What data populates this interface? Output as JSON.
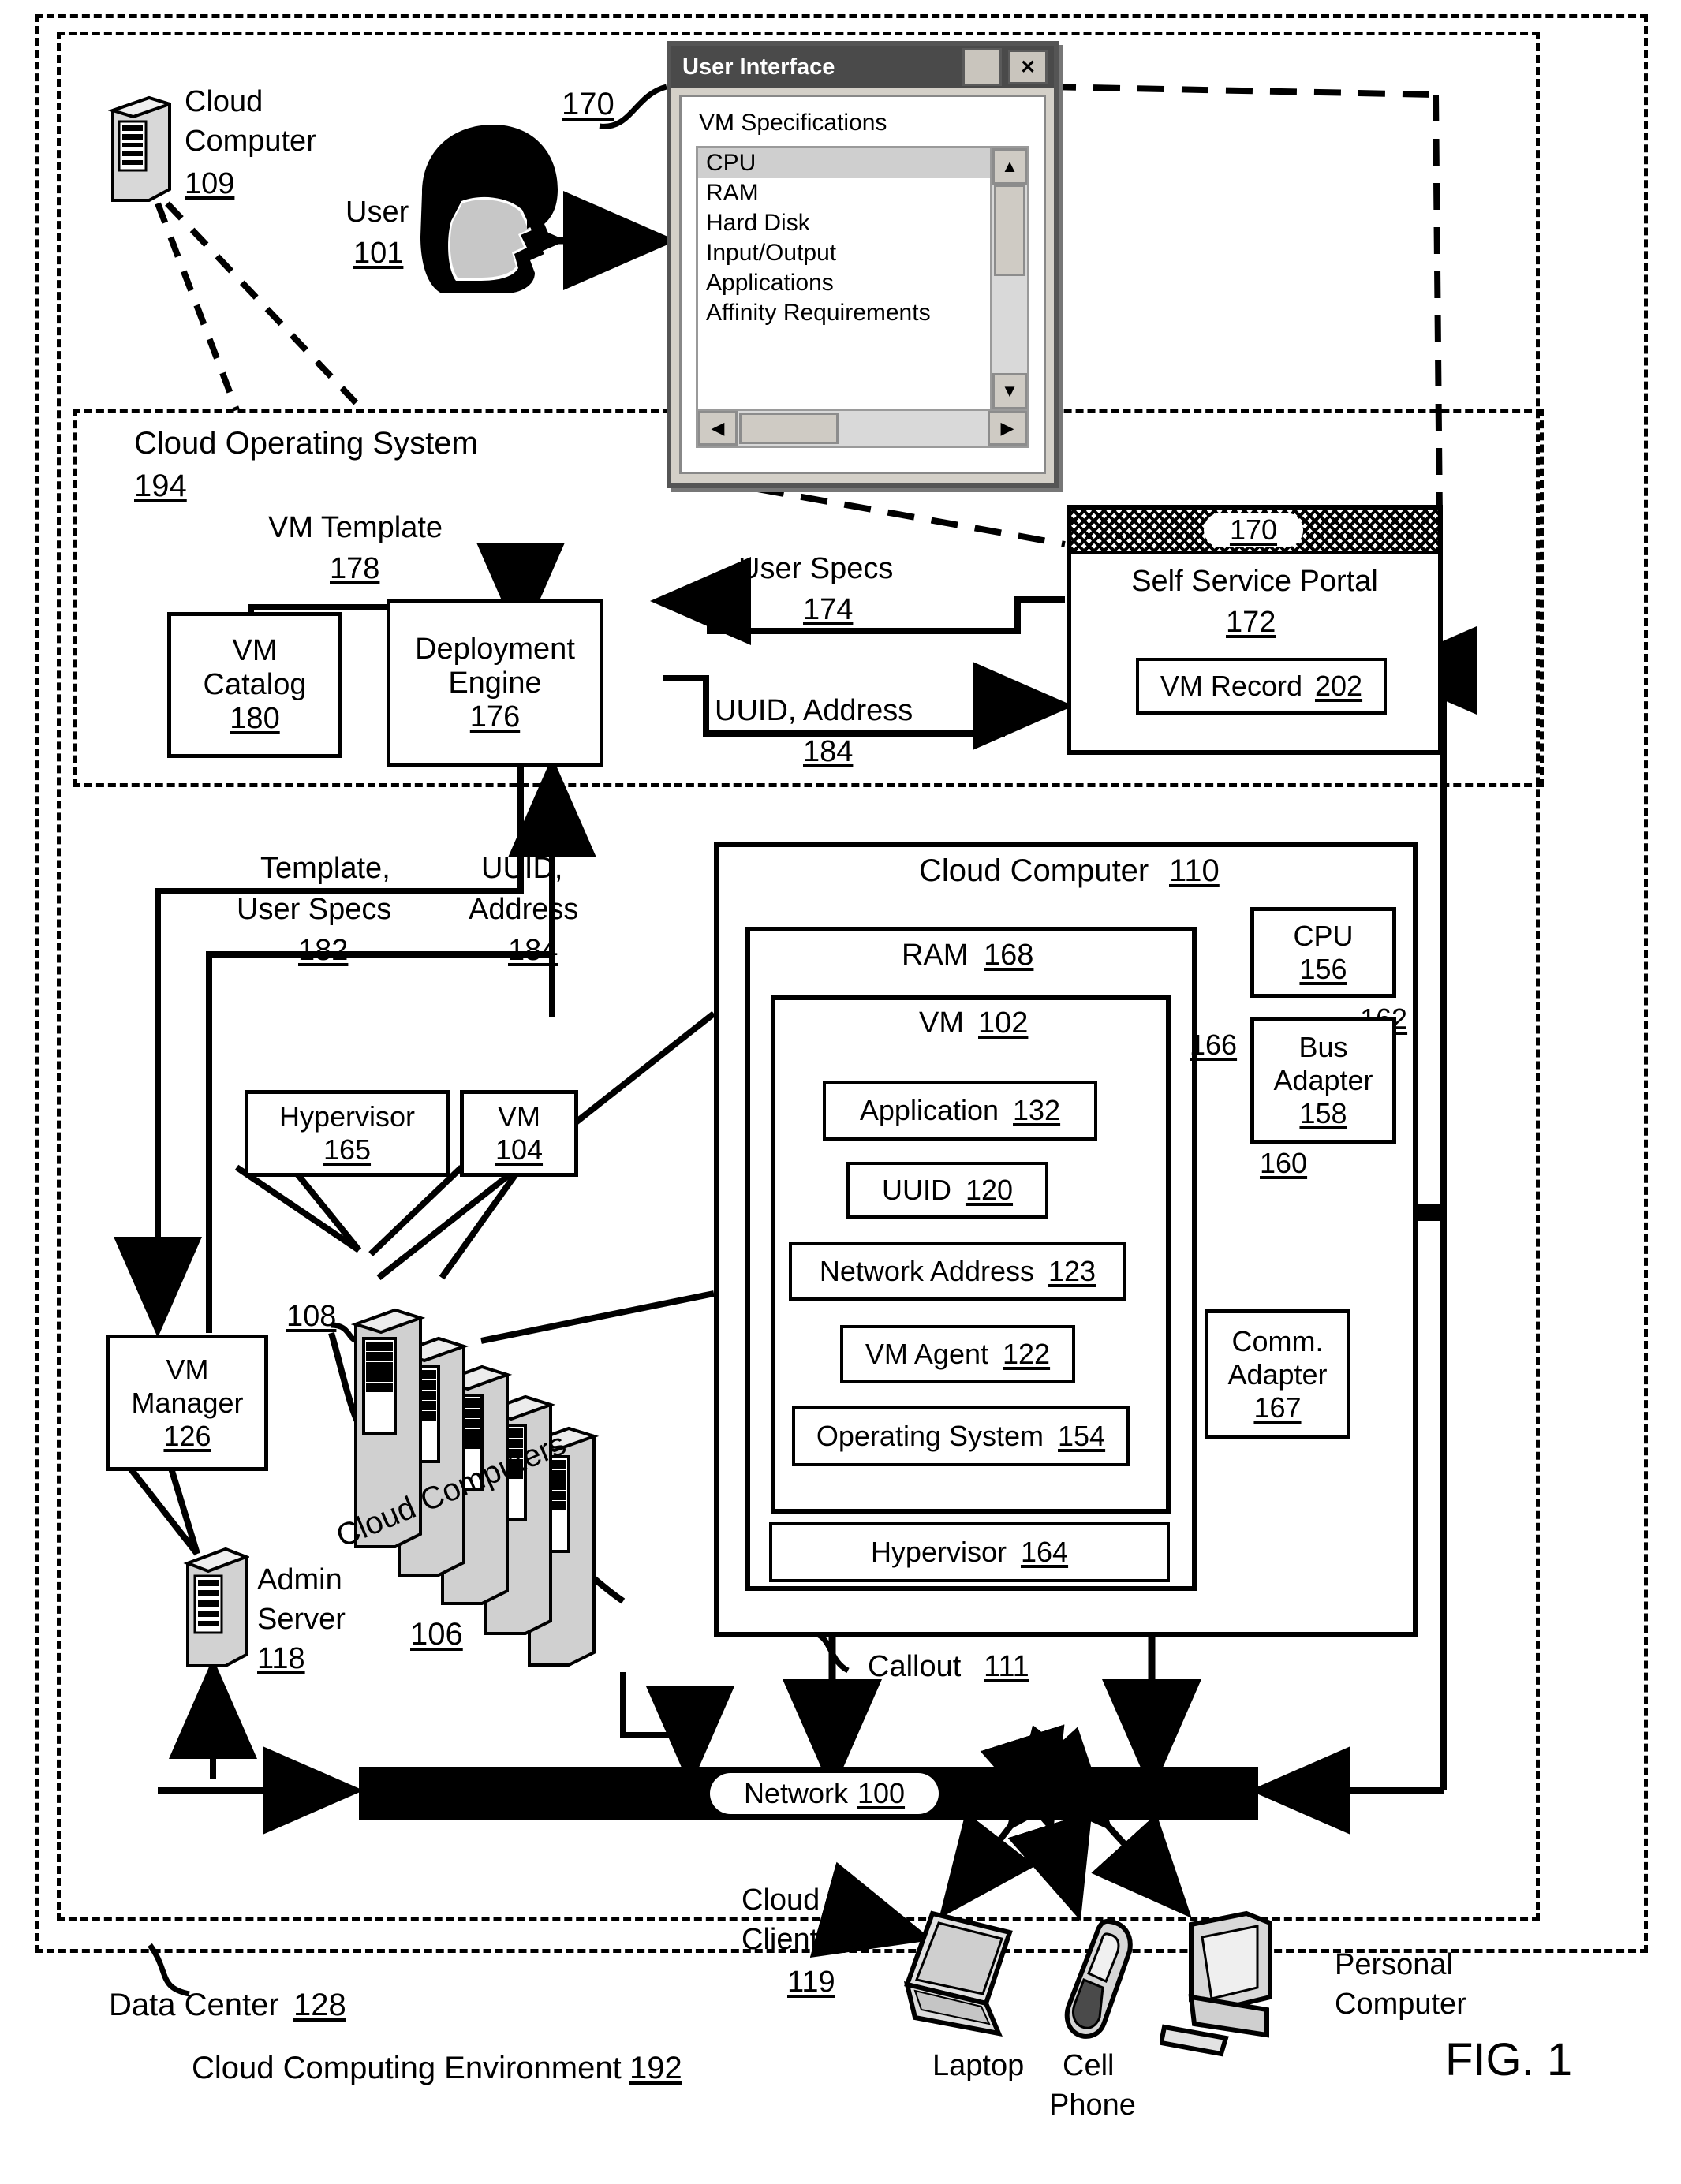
{
  "figure": {
    "label": "FIG. 1"
  },
  "frames": {
    "cloud_computing_environment": {
      "label": "Cloud Computing Environment",
      "ref": "192"
    },
    "data_center": {
      "label": "Data Center",
      "ref": "128"
    },
    "cloud_operating_system": {
      "label": "Cloud Operating System",
      "ref": "194"
    }
  },
  "top": {
    "cloud_computer_109": {
      "label_line1": "Cloud",
      "label_line2": "Computer",
      "ref": "109"
    },
    "user": {
      "label": "User",
      "ref": "101"
    },
    "ui_callout_ref": "170"
  },
  "ui_window": {
    "title": "User Interface",
    "minimize_glyph": "_",
    "close_glyph": "✕",
    "section_label": "VM Specifications",
    "list_items": [
      {
        "label": "CPU",
        "selected": true
      },
      {
        "label": "RAM",
        "selected": false
      },
      {
        "label": "Hard Disk",
        "selected": false
      },
      {
        "label": "Input/Output",
        "selected": false
      },
      {
        "label": "Applications",
        "selected": false
      },
      {
        "label": "Affinity Requirements",
        "selected": false
      }
    ],
    "scroll_up_glyph": "▲",
    "scroll_down_glyph": "▼",
    "scroll_left_glyph": "◀",
    "scroll_right_glyph": "▶"
  },
  "cos": {
    "vm_template": {
      "label": "VM Template",
      "ref": "178"
    },
    "vm_catalog": {
      "line1": "VM",
      "line2": "Catalog",
      "ref": "180"
    },
    "deployment_engine": {
      "line1": "Deployment",
      "line2": "Engine",
      "ref": "176"
    },
    "user_specs": {
      "label": "User Specs",
      "ref": "174"
    },
    "uuid_address_top": {
      "label": "UUID, Address",
      "ref": "184"
    },
    "self_service_portal": {
      "label": "Self Service Portal",
      "ref": "172",
      "band_ref": "170"
    },
    "vm_record": {
      "label": "VM Record",
      "ref": "202"
    }
  },
  "flows": {
    "template_user_specs": {
      "line1": "Template,",
      "line2": "User Specs",
      "ref": "182"
    },
    "uuid_address": {
      "line1": "UUID,",
      "line2": "Address",
      "ref": "184"
    }
  },
  "left": {
    "hypervisor_165": {
      "label": "Hypervisor",
      "ref": "165"
    },
    "vm_104": {
      "label": "VM",
      "ref": "104"
    },
    "server_stack_ref": "108",
    "cloud_computers": {
      "label": "Cloud Computers",
      "ref": "106"
    },
    "vm_manager": {
      "line1": "VM",
      "line2": "Manager",
      "ref": "126"
    },
    "admin_server": {
      "line1": "Admin",
      "line2": "Server",
      "ref": "118"
    }
  },
  "cloud_computer_110": {
    "title": "Cloud Computer",
    "ref": "110",
    "ram": {
      "label": "RAM",
      "ref": "168"
    },
    "vm": {
      "label": "VM",
      "ref": "102"
    },
    "inner_boxes": [
      {
        "label": "Application",
        "ref": "132"
      },
      {
        "label": "UUID",
        "ref": "120"
      },
      {
        "label": "Network Address",
        "ref": "123"
      },
      {
        "label": "VM Agent",
        "ref": "122"
      },
      {
        "label": "Operating System",
        "ref": "154"
      }
    ],
    "hypervisor": {
      "label": "Hypervisor",
      "ref": "164"
    },
    "cpu": {
      "label": "CPU",
      "ref": "156"
    },
    "bus_adapter": {
      "line1": "Bus",
      "line2": "Adapter",
      "ref": "158"
    },
    "comm_adapter": {
      "line1": "Comm.",
      "line2": "Adapter",
      "ref": "167"
    },
    "bus_162": "162",
    "bus_166": "166",
    "bus_160": "160",
    "callout": {
      "label": "Callout",
      "ref": "111"
    }
  },
  "network": {
    "label": "Network",
    "ref": "100"
  },
  "clients": {
    "group": {
      "line1": "Cloud",
      "line2": "Clients",
      "ref": "119"
    },
    "laptop": "Laptop",
    "cell_phone": {
      "line1": "Cell",
      "line2": "Phone"
    },
    "personal_computer": {
      "line1": "Personal",
      "line2": "Computer"
    }
  }
}
